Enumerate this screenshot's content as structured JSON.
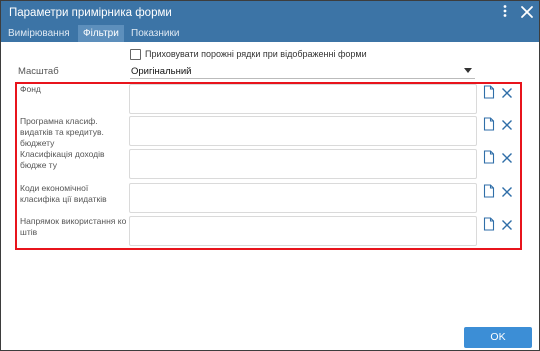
{
  "dialog": {
    "title": "Параметри примірника форми",
    "tabs": [
      {
        "label": "Вимірювання",
        "active": false
      },
      {
        "label": "Фільтри",
        "active": true
      },
      {
        "label": "Показники",
        "active": false
      }
    ],
    "hide_empty_rows": {
      "label": "Приховувати порожні рядки при відображенні форми",
      "checked": false
    },
    "scale": {
      "label": "Масштаб",
      "value": "Оригінальний"
    },
    "filters": [
      {
        "label": "Фонд",
        "value": ""
      },
      {
        "label": "Програмна класиф. видатків та кредитув. бюджету",
        "value": ""
      },
      {
        "label": "Класифікація доходів бюдже ту",
        "value": ""
      },
      {
        "label": "Коди економічної класифіка ції видатків",
        "value": ""
      },
      {
        "label": "Напрямок використання ко штів",
        "value": ""
      }
    ],
    "ok_label": "OK"
  },
  "colors": {
    "titlebar": "#3c74a6",
    "active_tab": "#5d8fbc",
    "highlight_border": "#e8141c",
    "icon_blue": "#2f6ea8",
    "ok_button": "#3c8ed6"
  },
  "icons": {
    "menu": "kebab-menu-icon",
    "close": "close-icon",
    "row_select": "document-icon",
    "row_clear": "close-icon"
  }
}
